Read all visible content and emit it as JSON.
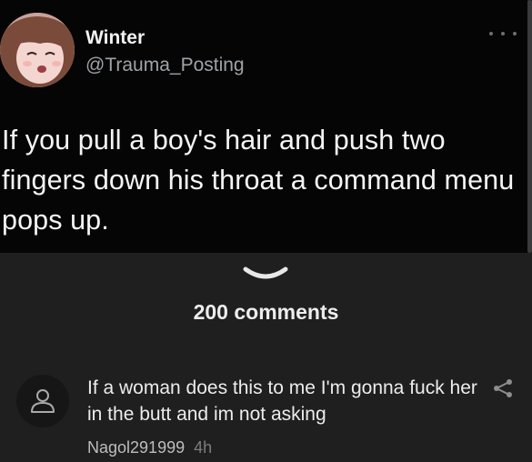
{
  "tweet": {
    "author_name": "Winter",
    "author_handle": "@Trauma_Posting",
    "text": "If you pull a boy's hair and push two fingers down his throat a command menu pops up."
  },
  "comments_section": {
    "count_label": "200 comments"
  },
  "comment": {
    "text": "If a woman does this to me I'm gonna fuck her in the butt and im not asking",
    "author": "Nagol291999",
    "time": "4h"
  },
  "icons": {
    "more": "more-dots-icon",
    "expand": "chevron-down-icon",
    "avatar": "user-icon",
    "share": "share-icon"
  },
  "colors": {
    "tweet_bg": "#050505",
    "comments_bg": "#1f1f20",
    "secondary_text": "#9fa3a7"
  }
}
